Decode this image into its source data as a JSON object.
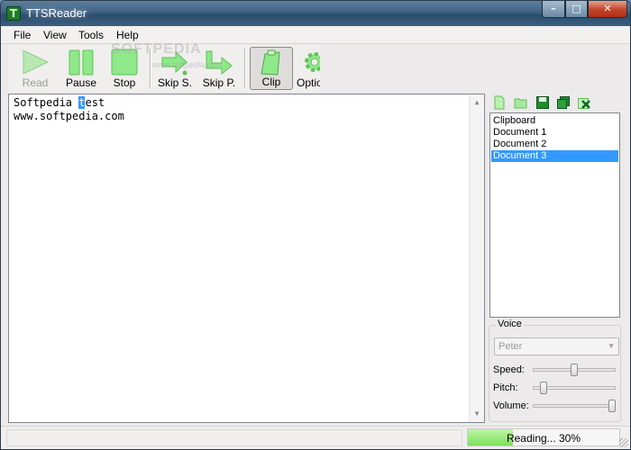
{
  "window": {
    "title": "TTSReader"
  },
  "menu": [
    "File",
    "View",
    "Tools",
    "Help"
  ],
  "toolbar": {
    "read": "Read",
    "pause": "Pause",
    "stop": "Stop",
    "skip_sentence": "Skip S.",
    "skip_paragraph": "Skip P.",
    "clip": "Clip",
    "options": "Optio"
  },
  "watermark": {
    "main": "SOFTPEDIA",
    "sub": "www.softpedia.com"
  },
  "editor": {
    "line1_before": "Softpedia ",
    "line1_selected": "t",
    "line1_after": "est",
    "line2": "www.softpedia.com"
  },
  "documents": [
    "Clipboard",
    "Document 1",
    "Document 2",
    "Document 3"
  ],
  "selected_document": "Document 3",
  "voice": {
    "group_label": "Voice",
    "selected": "Peter",
    "speed_label": "Speed:",
    "pitch_label": "Pitch:",
    "volume_label": "Volume:",
    "speed_level": 0.5,
    "pitch_level": 0.1,
    "volume_level": 1.0
  },
  "status": {
    "progress_text": "Reading... 30%",
    "progress_value": 0.3
  },
  "colors": {
    "selection": "#3399ff",
    "progress_fill": "#7ee05c",
    "icon_green": "#7fe07a"
  }
}
